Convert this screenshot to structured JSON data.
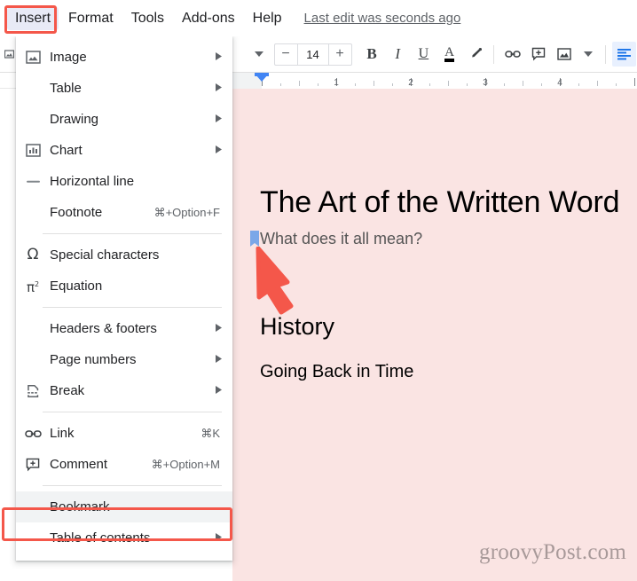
{
  "menubar": {
    "items": [
      {
        "label": "Insert",
        "active": true
      },
      {
        "label": "Format",
        "active": false
      },
      {
        "label": "Tools",
        "active": false
      },
      {
        "label": "Add-ons",
        "active": false
      },
      {
        "label": "Help",
        "active": false
      }
    ],
    "last_edit": "Last edit was seconds ago"
  },
  "toolbar": {
    "font_size": "14",
    "decrease_label": "−",
    "increase_label": "+",
    "bold_label": "B",
    "italic_label": "I",
    "underline_label": "U",
    "text_color_label": "A",
    "highlight_name": "highlight-pen",
    "link_name": "link",
    "comment_name": "add-comment",
    "image_name": "insert-image",
    "align_name": "align-left"
  },
  "ruler": {
    "numbers": [
      "1",
      "2",
      "3",
      "4"
    ]
  },
  "document": {
    "title": "The Art of the Written Word",
    "subtitle": "What does it all mean?",
    "heading2": "History",
    "paragraph": "Going Back in Time",
    "background_color": "#fae4e3",
    "bookmark_marker_color": "#7ba7e8",
    "watermark": "groovyPost.com"
  },
  "annotation": {
    "arrow_color": "#f4574a",
    "highlight_color": "#f4574a"
  },
  "insert_menu": {
    "items": [
      {
        "label": "Image",
        "icon": "image-icon",
        "accel": "",
        "submenu": true,
        "sep_after": false,
        "hovered": false
      },
      {
        "label": "Table",
        "icon": "",
        "accel": "",
        "submenu": true,
        "sep_after": false,
        "hovered": false
      },
      {
        "label": "Drawing",
        "icon": "",
        "accel": "",
        "submenu": true,
        "sep_after": false,
        "hovered": false
      },
      {
        "label": "Chart",
        "icon": "chart-icon",
        "accel": "",
        "submenu": true,
        "sep_after": false,
        "hovered": false
      },
      {
        "label": "Horizontal line",
        "icon": "horizontal-line-icon",
        "accel": "",
        "submenu": false,
        "sep_after": false,
        "hovered": false
      },
      {
        "label": "Footnote",
        "icon": "",
        "accel": "⌘+Option+F",
        "submenu": false,
        "sep_after": true,
        "hovered": false
      },
      {
        "label": "Special characters",
        "icon": "omega-icon",
        "accel": "",
        "submenu": false,
        "sep_after": false,
        "hovered": false
      },
      {
        "label": "Equation",
        "icon": "equation-icon",
        "accel": "",
        "submenu": false,
        "sep_after": true,
        "hovered": false
      },
      {
        "label": "Headers & footers",
        "icon": "",
        "accel": "",
        "submenu": true,
        "sep_after": false,
        "hovered": false
      },
      {
        "label": "Page numbers",
        "icon": "",
        "accel": "",
        "submenu": true,
        "sep_after": false,
        "hovered": false
      },
      {
        "label": "Break",
        "icon": "break-icon",
        "accel": "",
        "submenu": true,
        "sep_after": true,
        "hovered": false
      },
      {
        "label": "Link",
        "icon": "link-icon",
        "accel": "⌘K",
        "submenu": false,
        "sep_after": false,
        "hovered": false
      },
      {
        "label": "Comment",
        "icon": "comment-icon",
        "accel": "⌘+Option+M",
        "submenu": false,
        "sep_after": true,
        "hovered": false
      },
      {
        "label": "Bookmark",
        "icon": "",
        "accel": "",
        "submenu": false,
        "sep_after": false,
        "hovered": true
      },
      {
        "label": "Table of contents",
        "icon": "",
        "accel": "",
        "submenu": true,
        "sep_after": false,
        "hovered": false
      }
    ]
  }
}
